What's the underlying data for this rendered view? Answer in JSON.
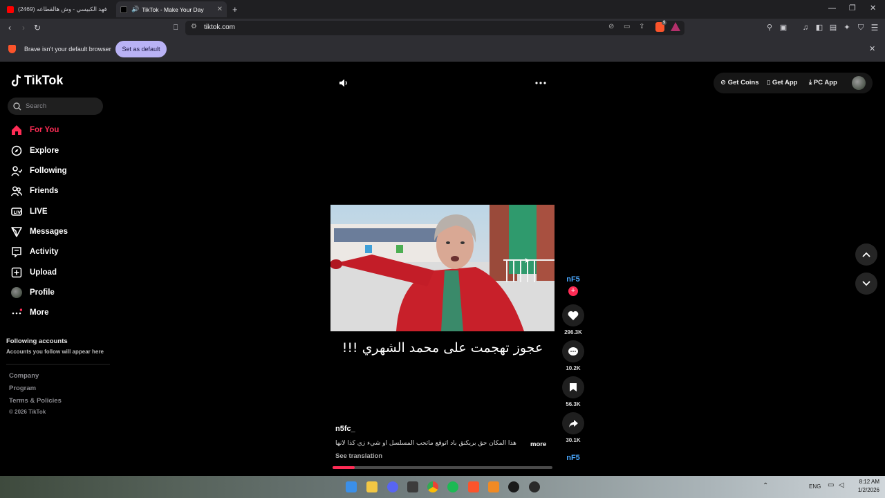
{
  "browser": {
    "tabs": [
      {
        "title": "(2469) فهد الكبيسي - وش هالقطاعه",
        "active": false
      },
      {
        "title": "TikTok - Make Your Day",
        "active": true
      }
    ],
    "url": "tiktok.com",
    "shield_badge": "9",
    "infobar": {
      "message": "Brave isn't your default browser",
      "button": "Set as default"
    }
  },
  "tiktok": {
    "logo": "TikTok",
    "search_placeholder": "Search",
    "nav": [
      {
        "label": "For You",
        "icon": "home-icon",
        "active": true
      },
      {
        "label": "Explore",
        "icon": "compass-icon"
      },
      {
        "label": "Following",
        "icon": "following-icon"
      },
      {
        "label": "Friends",
        "icon": "friends-icon"
      },
      {
        "label": "LIVE",
        "icon": "live-icon"
      },
      {
        "label": "Messages",
        "icon": "messages-icon"
      },
      {
        "label": "Activity",
        "icon": "activity-icon"
      },
      {
        "label": "Upload",
        "icon": "upload-icon"
      },
      {
        "label": "Profile",
        "icon": "avatar-icon"
      },
      {
        "label": "More",
        "icon": "more-icon"
      }
    ],
    "following_title": "Following accounts",
    "following_desc": "Accounts you follow will appear here",
    "footer": [
      "Company",
      "Program",
      "Terms & Policies",
      "© 2026 TikTok"
    ],
    "top_right": {
      "coins": "Get Coins",
      "app": "Get App",
      "pc": "PC App"
    }
  },
  "video": {
    "caption": "عجوز تهجمت على محمد الشهري !!!",
    "username": "n5fc_",
    "description": "هذا المكان حق بريكنق باد اتوقع ماتحب المسلسل او شيء زي كذا لانها",
    "more": "more",
    "see_translation": "See translation",
    "avatar_text": "nF5",
    "likes": "296.3K",
    "comments": "10.2K",
    "saves": "56.3K",
    "shares": "30.1K",
    "progress": 0.1
  },
  "taskbar": {
    "lang": "ENG",
    "time": "8:12 AM",
    "date": "1/2/2026"
  },
  "colors": {
    "accent": "#fe2c55",
    "infobar_button": "#b9b2f5"
  }
}
